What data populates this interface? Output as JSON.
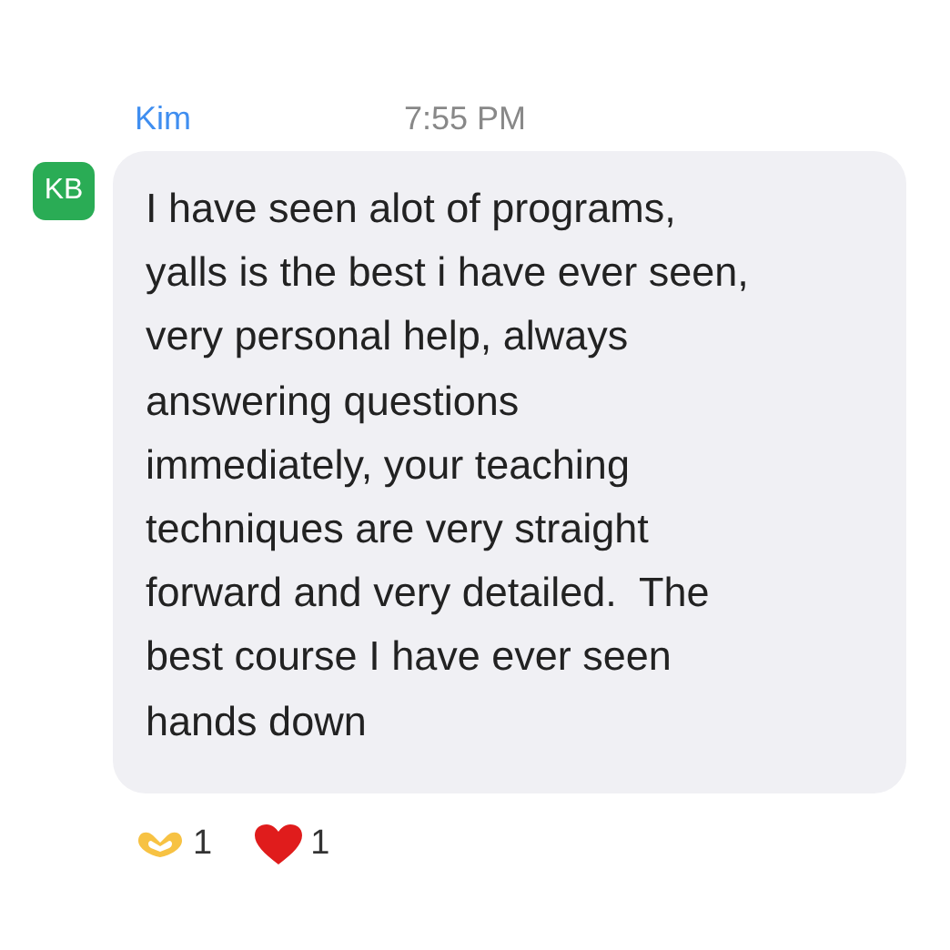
{
  "message": {
    "avatar_initials": "KB",
    "sender": "Kim",
    "time": "7:55 PM",
    "text": "I have seen alot of programs,\nyalls is the best i have ever seen,\nvery personal help, always\nanswering questions\nimmediately, your teaching\ntechniques are very straight\nforward and very detailed.  The\nbest course I have ever seen\nhands down"
  },
  "reactions": [
    {
      "kind": "heart-hands",
      "count": "1"
    },
    {
      "kind": "heart",
      "count": "1"
    }
  ]
}
